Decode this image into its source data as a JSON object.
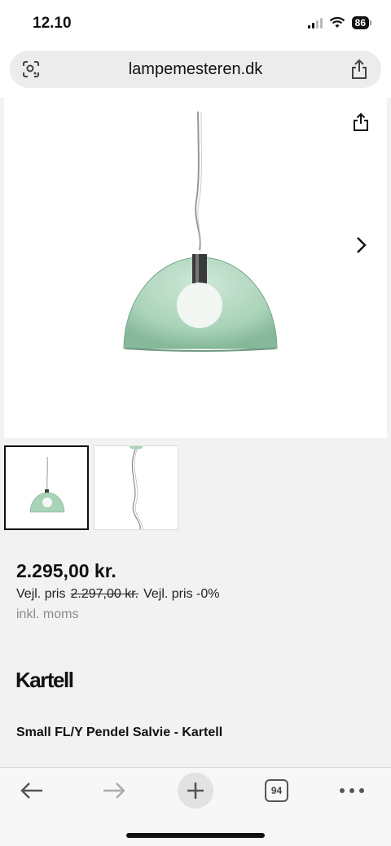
{
  "status": {
    "time": "12.10",
    "battery": "86"
  },
  "browser": {
    "url": "lampemesteren.dk",
    "tab_count": "94"
  },
  "product": {
    "price": "2.295,00 kr.",
    "vejl_label": "Vejl. pris",
    "vejl_old_price": "2.297,00 kr.",
    "vejl_discount": "Vejl. pris -0%",
    "vat_note": "inkl. moms",
    "brand": "Kartell",
    "title": "Small FL/Y Pendel Salvie - Kartell"
  },
  "colors": {
    "lamp_green": "#a9d3b8",
    "accent": "#111111"
  },
  "icons": [
    "camera-search-icon",
    "share-icon",
    "chevron-right-icon",
    "back-arrow-icon",
    "forward-arrow-icon",
    "plus-icon",
    "tabs-icon",
    "more-icon"
  ]
}
